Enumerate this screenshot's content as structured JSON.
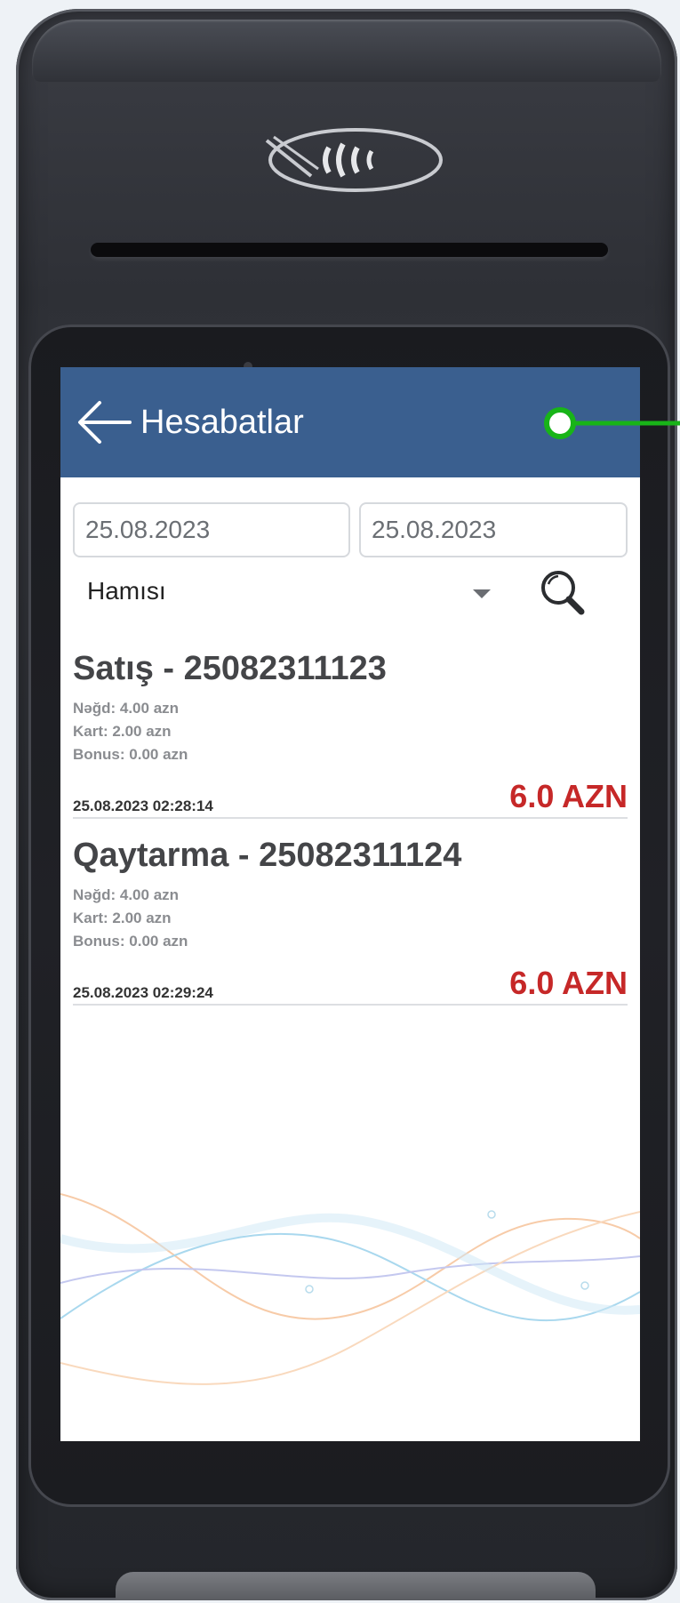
{
  "header": {
    "title": "Hesabatlar"
  },
  "filters": {
    "date_from": "25.08.2023",
    "date_to": "25.08.2023",
    "type_selected": "Hamısı"
  },
  "transactions": [
    {
      "title": "Satış - 25082311123",
      "cash": "Nəğd: 4.00  azn",
      "card": "Kart: 2.00  azn",
      "bonus": "Bonus: 0.00  azn",
      "datetime": "25.08.2023 02:28:14",
      "amount": "6.0 AZN"
    },
    {
      "title": "Qaytarma - 25082311124",
      "cash": "Nəğd: 4.00  azn",
      "card": "Kart: 2.00  azn",
      "bonus": "Bonus: 0.00  azn",
      "datetime": "25.08.2023 02:29:24",
      "amount": "6.0 AZN"
    }
  ],
  "colors": {
    "appbar": "#3a5f8f",
    "amount": "#c62828",
    "callout": "#18b418"
  },
  "icons": {
    "back": "arrow-left-icon",
    "dropdown": "chevron-down-icon",
    "search": "search-icon",
    "nfc": "contactless-icon"
  }
}
